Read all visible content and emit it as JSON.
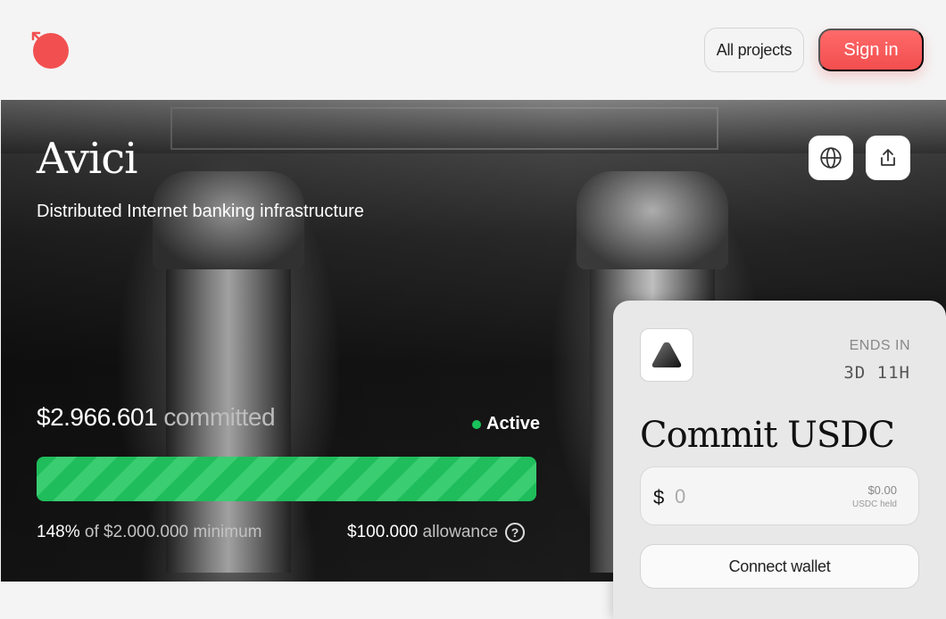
{
  "header": {
    "logo_icon": "logo-circle-arrow-icon",
    "all_projects_label": "All projects",
    "sign_in_label": "Sign in"
  },
  "hero": {
    "title": "Avici",
    "subtitle": "Distributed Internet banking infrastructure",
    "website_icon": "globe-icon",
    "share_icon": "share-icon",
    "committed_amount": "$2.966.601",
    "committed_label": "committed",
    "status_label": "Active",
    "progress_fraction": 1.0,
    "percent": "148%",
    "of_label": "of",
    "minimum_amount": "$2.000.000",
    "minimum_label": "minimum",
    "allowance_amount": "$100.000",
    "allowance_label": "allowance",
    "help_icon": "question-circle-icon"
  },
  "commit_card": {
    "token_icon": "avici-token-icon",
    "ends_label": "ENDS IN",
    "ends_value": "3D 11H",
    "title": "Commit USDC",
    "currency_symbol": "$",
    "amount_placeholder": "0",
    "held_value": "$0.00",
    "held_label": "USDC held",
    "connect_label": "Connect wallet"
  },
  "colors": {
    "accent": "#f24e4e",
    "status_green": "#19c25a",
    "progress_green": "#1fbd5b"
  }
}
